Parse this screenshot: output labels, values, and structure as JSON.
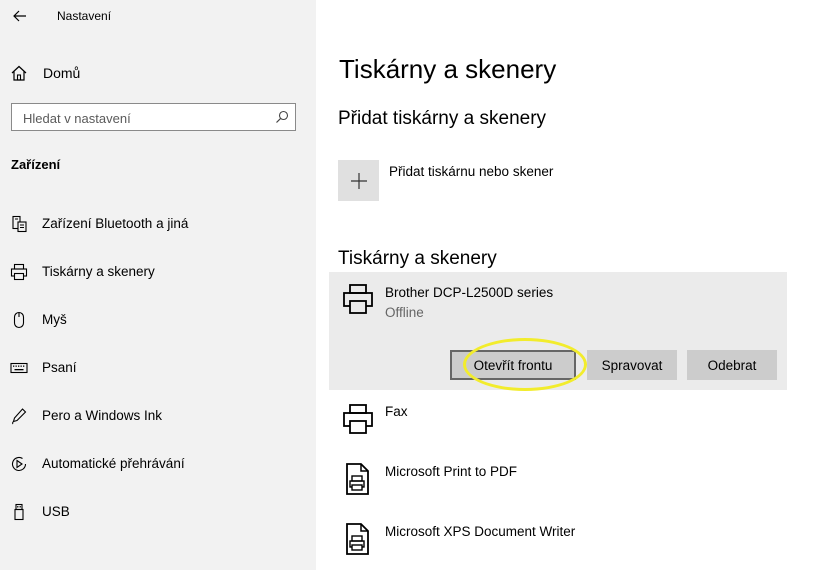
{
  "app": {
    "title": "Nastavení"
  },
  "sidebar": {
    "home_label": "Domů",
    "search_placeholder": "Hledat v nastavení",
    "section_title": "Zařízení",
    "items": [
      {
        "label": "Zařízení Bluetooth a jiná",
        "icon": "bluetooth-devices-icon"
      },
      {
        "label": "Tiskárny a skenery",
        "icon": "printer-icon"
      },
      {
        "label": "Myš",
        "icon": "mouse-icon"
      },
      {
        "label": "Psaní",
        "icon": "keyboard-icon"
      },
      {
        "label": "Pero a Windows Ink",
        "icon": "pen-icon"
      },
      {
        "label": "Automatické přehrávání",
        "icon": "autoplay-icon"
      },
      {
        "label": "USB",
        "icon": "usb-icon"
      }
    ]
  },
  "main": {
    "page_title": "Tiskárny a skenery",
    "add_section_title": "Přidat tiskárny a skenery",
    "add_label": "Přidat tiskárnu nebo skener",
    "list_title": "Tiskárny a skenery",
    "printers": [
      {
        "name": "Brother DCP-L2500D series",
        "status": "Offline",
        "icon": "printer-icon"
      },
      {
        "name": "Fax",
        "icon": "fax-icon"
      },
      {
        "name": "Microsoft Print to PDF",
        "icon": "document-printer-icon"
      },
      {
        "name": "Microsoft XPS Document Writer",
        "icon": "document-printer-icon"
      }
    ],
    "actions": {
      "open_queue": "Otevřít frontu",
      "manage": "Spravovat",
      "remove": "Odebrat"
    }
  },
  "colors": {
    "sidebar_bg": "#f2f2f2",
    "selected_bg": "#ebebeb",
    "button_bg": "#cccccc",
    "highlight": "#f2ec2c"
  }
}
